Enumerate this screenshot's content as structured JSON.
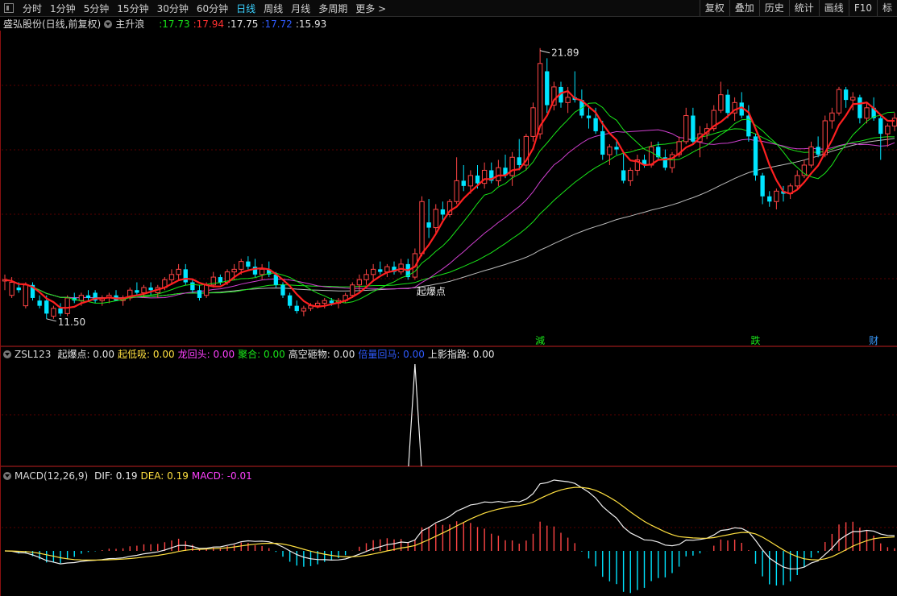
{
  "toolbar": {
    "periods": [
      "分时",
      "1分钟",
      "5分钟",
      "15分钟",
      "30分钟",
      "60分钟",
      "日线",
      "周线",
      "月线",
      "多周期",
      "更多 >"
    ],
    "active_period": "日线",
    "tools": [
      "复权",
      "叠加",
      "历史",
      "统计",
      "画线",
      "F10",
      "标"
    ]
  },
  "main_panel": {
    "stock_title": "盛弘股份(日线,前复权)",
    "indicator_name": "主升浪",
    "ma_values": [
      {
        "text": ":17.73",
        "color": "#19e619"
      },
      {
        "text": ":17.94",
        "color": "#ff3030"
      },
      {
        "text": ":17.75",
        "color": "#e0e0e0"
      },
      {
        "text": ":17.72",
        "color": "#2f5bff"
      },
      {
        "text": ":15.93",
        "color": "#e0e0e0"
      }
    ],
    "high_label": "21.89",
    "low_label": "11.50",
    "signal_label": "起爆点",
    "markers": [
      {
        "text": "減",
        "color": "#19e619",
        "i": 77
      },
      {
        "text": "跌",
        "color": "#19e619",
        "i": 108
      },
      {
        "text": "财",
        "color": "#3a9bff",
        "i": 125
      }
    ]
  },
  "zsl_panel": {
    "title": "ZSL123",
    "items": [
      {
        "label": "起爆点: 0.00",
        "color": "#e8e8e8"
      },
      {
        "label": "起低吸: 0.00",
        "color": "#ffe040"
      },
      {
        "label": "龙回头: 0.00",
        "color": "#ff40ff"
      },
      {
        "label": "聚合: 0.00",
        "color": "#19e619"
      },
      {
        "label": "高空砸物: 0.00",
        "color": "#e8e8e8"
      },
      {
        "label": "倍量回马: 0.00",
        "color": "#2f5bff"
      },
      {
        "label": "上影指路: 0.00",
        "color": "#e8e8e8"
      }
    ]
  },
  "macd_panel": {
    "title": "MACD(12,26,9)",
    "items": [
      {
        "label": "DIF: 0.19",
        "color": "#e8e8e8"
      },
      {
        "label": "DEA: 0.19",
        "color": "#ffe040"
      },
      {
        "label": "MACD: -0.01",
        "color": "#ff40ff"
      }
    ]
  },
  "colors": {
    "up": "#ff4545",
    "down": "#00e5ff",
    "grid": "#5a0000",
    "ma_red": "#ff2020",
    "ma_green": "#19e619",
    "ma_mag": "#d040d0",
    "ma_gray": "#bbbbbb"
  },
  "chart_data": {
    "type": "candlestick",
    "price_range": [
      11.0,
      22.5
    ],
    "candles": [
      [
        12.95,
        13.2,
        12.6,
        13.0
      ],
      [
        12.4,
        13.1,
        12.3,
        12.9
      ],
      [
        12.7,
        12.9,
        12.5,
        12.6
      ],
      [
        12.0,
        12.9,
        11.9,
        12.8
      ],
      [
        12.8,
        12.9,
        12.2,
        12.3
      ],
      [
        12.2,
        12.4,
        11.9,
        12.0
      ],
      [
        12.2,
        12.4,
        11.5,
        11.7
      ],
      [
        11.6,
        12.0,
        11.5,
        11.9
      ],
      [
        11.9,
        12.1,
        11.6,
        11.7
      ],
      [
        11.7,
        12.4,
        11.6,
        12.3
      ],
      [
        12.3,
        12.5,
        12.1,
        12.2
      ],
      [
        12.2,
        12.5,
        12.0,
        12.4
      ],
      [
        12.4,
        12.6,
        12.2,
        12.3
      ],
      [
        12.5,
        12.6,
        12.1,
        12.2
      ],
      [
        12.2,
        12.4,
        12.0,
        12.3
      ],
      [
        12.3,
        12.5,
        12.1,
        12.4
      ],
      [
        12.4,
        12.6,
        12.2,
        12.2
      ],
      [
        12.2,
        12.4,
        12.0,
        12.3
      ],
      [
        12.3,
        12.7,
        12.2,
        12.6
      ],
      [
        12.6,
        12.9,
        12.4,
        12.5
      ],
      [
        12.5,
        12.8,
        12.3,
        12.7
      ],
      [
        12.7,
        12.9,
        12.4,
        12.6
      ],
      [
        12.5,
        12.8,
        12.3,
        12.7
      ],
      [
        12.7,
        13.1,
        12.6,
        13.0
      ],
      [
        13.0,
        13.4,
        12.8,
        13.2
      ],
      [
        13.2,
        13.6,
        13.0,
        13.4
      ],
      [
        13.4,
        13.6,
        12.8,
        12.9
      ],
      [
        12.9,
        13.0,
        12.5,
        12.6
      ],
      [
        12.6,
        12.8,
        12.2,
        12.3
      ],
      [
        12.4,
        12.9,
        12.3,
        12.8
      ],
      [
        12.8,
        13.3,
        12.7,
        13.1
      ],
      [
        13.1,
        13.2,
        12.8,
        12.9
      ],
      [
        12.9,
        13.4,
        12.8,
        13.3
      ],
      [
        13.3,
        13.6,
        13.0,
        13.4
      ],
      [
        13.4,
        13.8,
        13.2,
        13.7
      ],
      [
        13.7,
        13.9,
        13.4,
        13.5
      ],
      [
        13.5,
        13.8,
        13.1,
        13.2
      ],
      [
        13.2,
        13.6,
        13.0,
        13.4
      ],
      [
        13.4,
        13.7,
        13.1,
        13.2
      ],
      [
        13.2,
        13.3,
        12.7,
        12.8
      ],
      [
        12.8,
        12.9,
        12.3,
        12.4
      ],
      [
        12.4,
        12.5,
        11.9,
        12.0
      ],
      [
        12.0,
        12.2,
        11.7,
        11.8
      ],
      [
        11.8,
        12.0,
        11.6,
        11.9
      ],
      [
        11.9,
        12.1,
        11.8,
        12.0
      ],
      [
        12.0,
        12.2,
        11.9,
        12.1
      ],
      [
        12.1,
        12.3,
        11.9,
        12.2
      ],
      [
        12.2,
        12.3,
        12.0,
        12.1
      ],
      [
        12.1,
        12.3,
        11.9,
        12.2
      ],
      [
        12.2,
        12.5,
        12.1,
        12.4
      ],
      [
        12.4,
        12.9,
        12.3,
        12.8
      ],
      [
        12.8,
        13.2,
        12.6,
        13.0
      ],
      [
        13.0,
        13.4,
        12.8,
        13.2
      ],
      [
        13.2,
        13.6,
        13.0,
        13.4
      ],
      [
        13.4,
        13.7,
        13.2,
        13.3
      ],
      [
        13.3,
        13.6,
        13.1,
        13.5
      ],
      [
        13.5,
        13.7,
        13.2,
        13.3
      ],
      [
        13.3,
        13.8,
        13.2,
        13.6
      ],
      [
        13.6,
        13.8,
        13.0,
        13.1
      ],
      [
        13.1,
        14.2,
        13.0,
        14.0
      ],
      [
        14.0,
        16.2,
        13.9,
        16.0
      ],
      [
        15.2,
        16.1,
        14.6,
        15.0
      ],
      [
        15.0,
        15.9,
        14.8,
        15.7
      ],
      [
        15.7,
        16.0,
        15.3,
        15.5
      ],
      [
        15.5,
        16.1,
        15.4,
        16.0
      ],
      [
        16.0,
        17.7,
        15.9,
        16.8
      ],
      [
        16.8,
        17.4,
        16.4,
        16.6
      ],
      [
        16.6,
        17.2,
        16.3,
        17.0
      ],
      [
        17.0,
        17.4,
        16.5,
        16.7
      ],
      [
        16.7,
        17.5,
        16.5,
        17.2
      ],
      [
        17.2,
        17.5,
        16.7,
        16.8
      ],
      [
        16.8,
        17.6,
        16.6,
        17.3
      ],
      [
        17.3,
        17.8,
        16.9,
        17.0
      ],
      [
        17.0,
        17.9,
        16.6,
        17.7
      ],
      [
        17.7,
        18.4,
        17.2,
        17.4
      ],
      [
        17.4,
        18.6,
        17.2,
        18.5
      ],
      [
        18.5,
        19.8,
        18.3,
        19.6
      ],
      [
        18.6,
        21.89,
        18.4,
        21.3
      ],
      [
        21.0,
        21.5,
        19.4,
        19.7
      ],
      [
        19.7,
        20.6,
        19.5,
        20.4
      ],
      [
        20.4,
        20.6,
        19.6,
        19.8
      ],
      [
        19.8,
        20.4,
        19.4,
        20.0
      ],
      [
        20.0,
        21.0,
        19.8,
        19.9
      ],
      [
        19.9,
        20.3,
        19.2,
        19.3
      ],
      [
        19.3,
        19.7,
        18.8,
        19.2
      ],
      [
        19.2,
        19.6,
        18.6,
        18.7
      ],
      [
        18.7,
        19.1,
        17.6,
        17.8
      ],
      [
        17.8,
        18.2,
        17.4,
        18.1
      ],
      [
        18.1,
        18.4,
        17.8,
        18.0
      ],
      [
        17.2,
        17.9,
        16.7,
        16.8
      ],
      [
        16.8,
        17.3,
        16.6,
        17.2
      ],
      [
        17.2,
        17.8,
        17.0,
        17.6
      ],
      [
        17.6,
        17.8,
        17.3,
        17.4
      ],
      [
        17.4,
        18.3,
        17.3,
        18.1
      ],
      [
        18.1,
        18.3,
        17.6,
        17.7
      ],
      [
        17.7,
        18.0,
        17.2,
        17.3
      ],
      [
        17.3,
        17.9,
        17.1,
        17.8
      ],
      [
        17.8,
        18.5,
        17.7,
        18.3
      ],
      [
        18.3,
        19.6,
        18.2,
        19.3
      ],
      [
        19.3,
        19.6,
        18.2,
        18.3
      ],
      [
        18.3,
        18.9,
        17.7,
        18.6
      ],
      [
        18.6,
        19.0,
        18.4,
        18.8
      ],
      [
        18.8,
        19.7,
        18.7,
        19.5
      ],
      [
        19.5,
        20.6,
        19.4,
        20.1
      ],
      [
        20.1,
        20.3,
        19.2,
        19.4
      ],
      [
        19.4,
        20.0,
        19.1,
        19.8
      ],
      [
        19.8,
        20.2,
        19.2,
        19.3
      ],
      [
        19.3,
        19.7,
        18.3,
        18.5
      ],
      [
        18.5,
        18.6,
        16.8,
        17.0
      ],
      [
        17.0,
        17.1,
        15.9,
        16.2
      ],
      [
        16.2,
        16.4,
        15.8,
        16.0
      ],
      [
        16.0,
        16.5,
        15.7,
        16.4
      ],
      [
        16.4,
        16.6,
        16.0,
        16.3
      ],
      [
        16.3,
        16.7,
        16.1,
        16.6
      ],
      [
        16.6,
        17.2,
        16.5,
        17.0
      ],
      [
        17.0,
        17.6,
        16.9,
        17.4
      ],
      [
        17.4,
        18.3,
        17.3,
        18.1
      ],
      [
        18.1,
        18.5,
        17.7,
        17.8
      ],
      [
        17.8,
        19.3,
        17.7,
        19.1
      ],
      [
        19.1,
        19.6,
        18.8,
        19.4
      ],
      [
        19.4,
        20.4,
        19.3,
        20.3
      ],
      [
        20.3,
        20.4,
        19.6,
        19.9
      ],
      [
        19.9,
        20.2,
        19.5,
        20.0
      ],
      [
        20.0,
        20.1,
        19.0,
        19.2
      ],
      [
        19.2,
        19.8,
        19.0,
        19.6
      ],
      [
        19.6,
        20.0,
        19.1,
        19.2
      ],
      [
        19.2,
        19.3,
        17.6,
        18.6
      ],
      [
        18.6,
        19.0,
        18.1,
        18.9
      ],
      [
        18.9,
        19.4,
        18.7,
        19.2
      ]
    ],
    "signal_spike_index": 59,
    "zsl_values_note": "single spike of 1 at signal_spike_index, 0 elsewhere"
  }
}
